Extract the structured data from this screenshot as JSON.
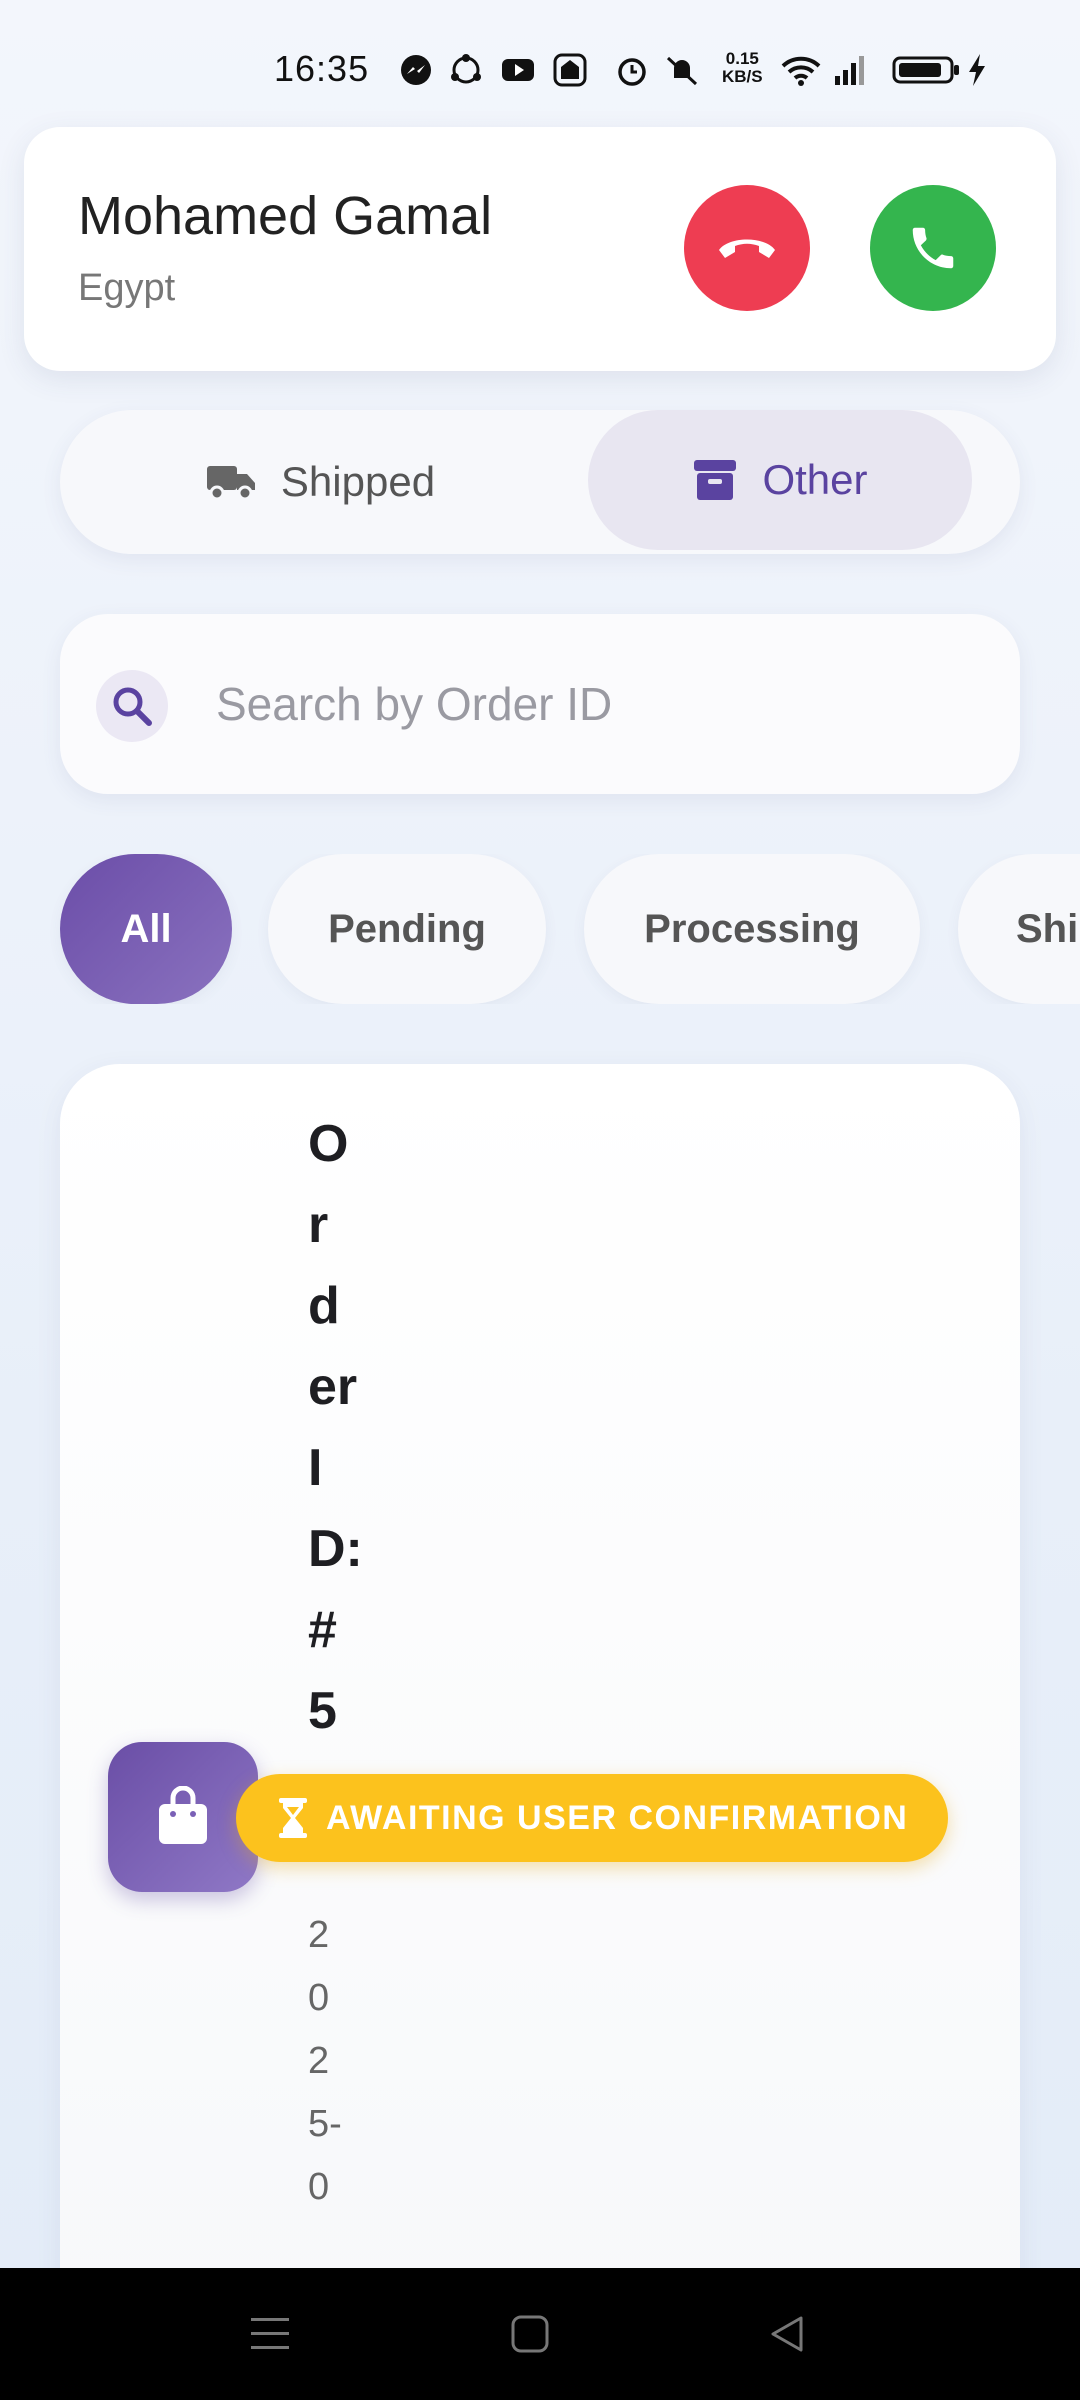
{
  "status_bar": {
    "time": "16:35",
    "net_speed_value": "0.15",
    "net_speed_unit": "KB/S",
    "icons": [
      "messenger-icon",
      "sync-icon",
      "youtube-icon",
      "app-icon",
      "alarm-icon",
      "mute-icon",
      "wifi-icon",
      "signal-icon",
      "battery-icon",
      "charging-icon"
    ]
  },
  "caller": {
    "name": "Mohamed Gamal",
    "country": "Egypt"
  },
  "colors": {
    "accent": "#5a43a0",
    "decline": "#ee3d52",
    "accept": "#34b54e",
    "status_awaiting": "#fcc21d"
  },
  "tabs": [
    {
      "label": "Shipped",
      "icon": "truck-icon",
      "selected": false
    },
    {
      "label": "Other",
      "icon": "archive-icon",
      "selected": true
    }
  ],
  "search": {
    "placeholder": "Search by Order ID",
    "value": ""
  },
  "filters": [
    {
      "label": "All",
      "selected": true
    },
    {
      "label": "Pending",
      "selected": false
    },
    {
      "label": "Processing",
      "selected": false
    },
    {
      "label": "Shi",
      "selected": false
    }
  ],
  "order": {
    "id_text": "Order ID: #5",
    "date_text": "2025-0",
    "status": "AWAITING USER CONFIRMATION",
    "icon": "shopping-bag-icon"
  },
  "nav": [
    "menu-icon",
    "home-icon",
    "back-icon"
  ]
}
